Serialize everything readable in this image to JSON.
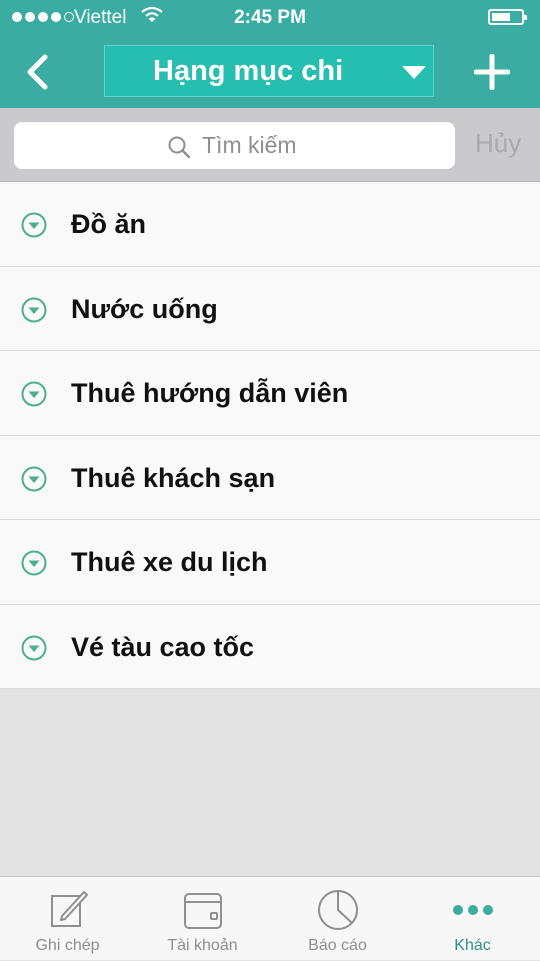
{
  "status_bar": {
    "carrier": "Viettel",
    "time": "2:45 PM",
    "signal_bars": 4,
    "signal_max": 5,
    "battery_level": 0.5
  },
  "header": {
    "title": "Hạng mục chi",
    "back_icon": "chevron-left-icon",
    "add_icon": "plus-icon",
    "dropdown_icon": "caret-down-icon"
  },
  "search": {
    "placeholder": "Tìm kiếm",
    "cancel_label": "Hủy"
  },
  "categories": [
    {
      "label": "Đồ ăn"
    },
    {
      "label": "Nước uống"
    },
    {
      "label": "Thuê hướng dẫn viên"
    },
    {
      "label": "Thuê khách sạn"
    },
    {
      "label": "Thuê xe du lịch"
    },
    {
      "label": "Vé tàu cao tốc"
    }
  ],
  "tab_bar": {
    "tabs": [
      {
        "label": "Ghi chép",
        "icon": "edit-icon",
        "active": false
      },
      {
        "label": "Tài khoản",
        "icon": "wallet-icon",
        "active": false
      },
      {
        "label": "Báo cáo",
        "icon": "pie-chart-icon",
        "active": false
      },
      {
        "label": "Khác",
        "icon": "more-icon",
        "active": true
      }
    ]
  },
  "colors": {
    "header": "#3aaca2",
    "title_box": "#26beb0",
    "accent": "#2f8f89",
    "chevron": "#4cae8f"
  }
}
